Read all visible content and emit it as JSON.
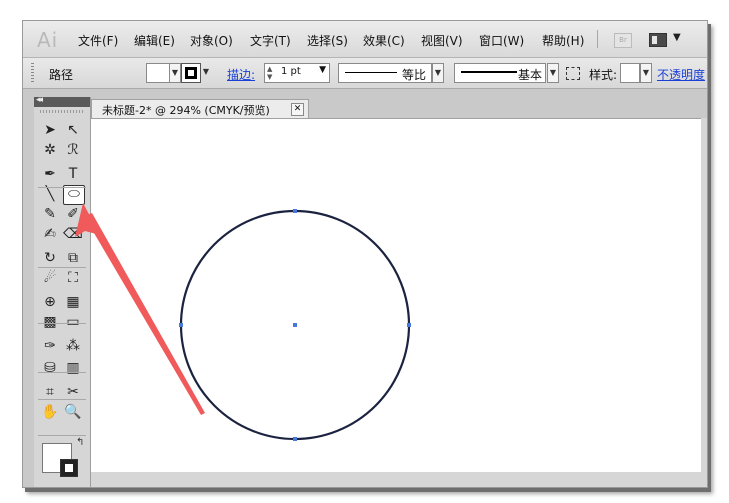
{
  "app": {
    "logo": "Ai"
  },
  "menu": {
    "items": [
      "文件(F)",
      "编辑(E)",
      "对象(O)",
      "文字(T)",
      "选择(S)",
      "效果(C)",
      "视图(V)",
      "窗口(W)",
      "帮助(H)"
    ],
    "bridge_label": "Br",
    "workspace_icon": "workspace-grid-icon"
  },
  "control": {
    "object_type": "路径",
    "stroke_label": "描边:",
    "stroke_weight": "1 pt",
    "profile_label": "等比",
    "brush_label": "基本",
    "style_label": "样式:",
    "opacity_label": "不透明度"
  },
  "document": {
    "tab_title": "未标题-2* @ 294% (CMYK/预览)",
    "close_glyph": "✕"
  },
  "tools": {
    "collapse_glyph": "◂◂",
    "selected_tool": "ellipse-tool",
    "items": [
      {
        "name": "selection-tool-icon",
        "glyph": "➤"
      },
      {
        "name": "direct-selection-tool-icon",
        "glyph": "↖"
      },
      {
        "name": "magic-wand-tool-icon",
        "glyph": "✲"
      },
      {
        "name": "lasso-tool-icon",
        "glyph": "ℛ"
      },
      {
        "name": "pen-tool-icon",
        "glyph": "✒"
      },
      {
        "name": "type-tool-icon",
        "glyph": "T"
      },
      {
        "name": "line-segment-tool-icon",
        "glyph": "╲"
      },
      {
        "name": "ellipse-tool-icon",
        "glyph": "⬭"
      },
      {
        "name": "paintbrush-tool-icon",
        "glyph": "✎"
      },
      {
        "name": "pencil-tool-icon",
        "glyph": "✐"
      },
      {
        "name": "blob-brush-tool-icon",
        "glyph": "✍"
      },
      {
        "name": "eraser-tool-icon",
        "glyph": "⌫"
      },
      {
        "name": "rotate-tool-icon",
        "glyph": "↻"
      },
      {
        "name": "scale-tool-icon",
        "glyph": "⧉"
      },
      {
        "name": "warp-tool-icon",
        "glyph": "☄"
      },
      {
        "name": "free-transform-tool-icon",
        "glyph": "⛶"
      },
      {
        "name": "shape-builder-tool-icon",
        "glyph": "⊕"
      },
      {
        "name": "perspective-grid-tool-icon",
        "glyph": "▦"
      },
      {
        "name": "mesh-tool-icon",
        "glyph": "▩"
      },
      {
        "name": "gradient-tool-icon",
        "glyph": "▭"
      },
      {
        "name": "eyedropper-tool-icon",
        "glyph": "✑"
      },
      {
        "name": "blend-tool-icon",
        "glyph": "⁂"
      },
      {
        "name": "symbol-sprayer-tool-icon",
        "glyph": "⛁"
      },
      {
        "name": "column-graph-tool-icon",
        "glyph": "▥"
      },
      {
        "name": "artboard-tool-icon",
        "glyph": "⌗"
      },
      {
        "name": "slice-tool-icon",
        "glyph": "✂"
      },
      {
        "name": "hand-tool-icon",
        "glyph": "✋"
      },
      {
        "name": "zoom-tool-icon",
        "glyph": "🔍"
      }
    ]
  },
  "colors": {
    "circle_stroke": "#1c2340",
    "anchor": "#4a78d8",
    "annotation_arrow": "#f05a5a"
  }
}
